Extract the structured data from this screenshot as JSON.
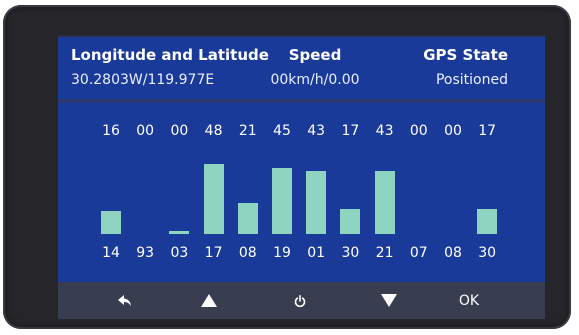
{
  "header": {
    "position": {
      "title": "Longitude and Latitude",
      "value": "30.2803W/119.977E"
    },
    "speed": {
      "title": "Speed",
      "value": "00km/h/0.00"
    },
    "gps_state": {
      "title": "GPS State",
      "value": "Positioned"
    }
  },
  "satellites": {
    "top_values": [
      "16",
      "00",
      "00",
      "48",
      "21",
      "45",
      "43",
      "17",
      "43",
      "00",
      "00",
      "17"
    ],
    "bottom_ids": [
      "14",
      "93",
      "03",
      "17",
      "08",
      "19",
      "01",
      "30",
      "21",
      "07",
      "08",
      "30"
    ],
    "signal_levels": [
      16,
      0,
      0,
      48,
      21,
      45,
      43,
      17,
      43,
      0,
      0,
      17
    ],
    "bar_color": "#8fd4c1"
  },
  "footer": {
    "back_icon": "back-arrow-icon",
    "up_icon": "up-triangle-icon",
    "power_icon": "power-icon",
    "down_icon": "down-triangle-icon",
    "ok_label": "OK"
  },
  "colors": {
    "screen_bg": "#1a3a99",
    "footer_bg": "#383d4f",
    "bezel": "#25252a"
  }
}
